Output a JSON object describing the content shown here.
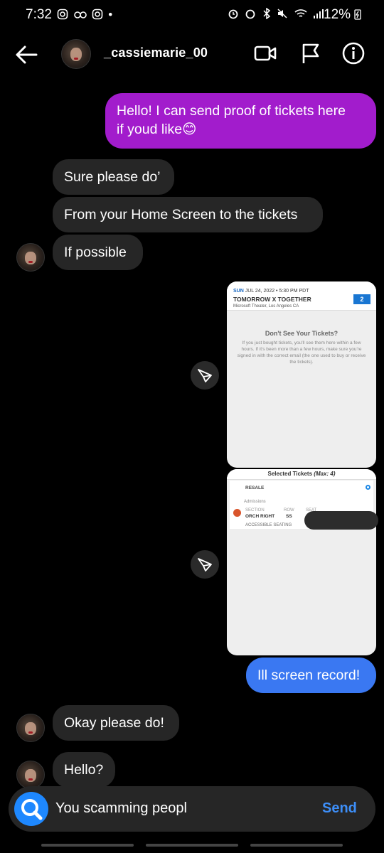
{
  "status_bar": {
    "time": "7:32",
    "left_icons": [
      "instagram-icon",
      "app-icon",
      "instagram-icon"
    ],
    "battery": "12%"
  },
  "header": {
    "username": "_cassiemarie_00",
    "icons": [
      "back-arrow-icon",
      "video-call-icon",
      "flag-icon",
      "info-icon"
    ]
  },
  "messages": [
    {
      "side": "out",
      "text_lines": [
        "Hello! I can send proof of tickets here",
        "if youd like😊"
      ]
    },
    {
      "side": "in",
      "text": "Sure please do’"
    },
    {
      "side": "in",
      "text": "From your Home Screen to the tickets"
    },
    {
      "side": "in",
      "text": "If possible"
    },
    {
      "side": "out",
      "text": "Ill screen record!"
    },
    {
      "side": "in",
      "text": "Okay please do!"
    },
    {
      "side": "in",
      "text": "Hello?"
    }
  ],
  "ticket_screenshot_1": {
    "day": "SUN",
    "date": "JUL 24, 2022 • 5:30 PM PDT",
    "event": "TOMORROW X TOGETHER",
    "venue": "Microsoft Theater, Los Angeles CA",
    "ticket_count": "2",
    "heading": "Don't See Your Tickets?",
    "body": "If you just bought tickets, you'll see them here within a few hours. If it's been more than a few hours, make sure you're signed in with the correct email (the one used to buy or receive the tickets)."
  },
  "ticket_screenshot_2": {
    "title": "Selected Tickets",
    "title_max": "(Max: 4)",
    "resale": "RESALE",
    "admissions": "Admissions",
    "section_label": "SECTION",
    "row_label": "ROW",
    "seat_label": "SEAT",
    "section_value": "ORCH RIGHT",
    "row_value": "SS",
    "accessible": "ACCESSIBLE SEATING"
  },
  "composer": {
    "draft_text": "You scamming peopl",
    "send_label": "Send"
  },
  "colors": {
    "background": "#000000",
    "incoming_bubble": "#262626",
    "outgoing_purple": "#a21ccc",
    "outgoing_blue": "#3a78f2",
    "send_accent": "#3d8ef7"
  }
}
